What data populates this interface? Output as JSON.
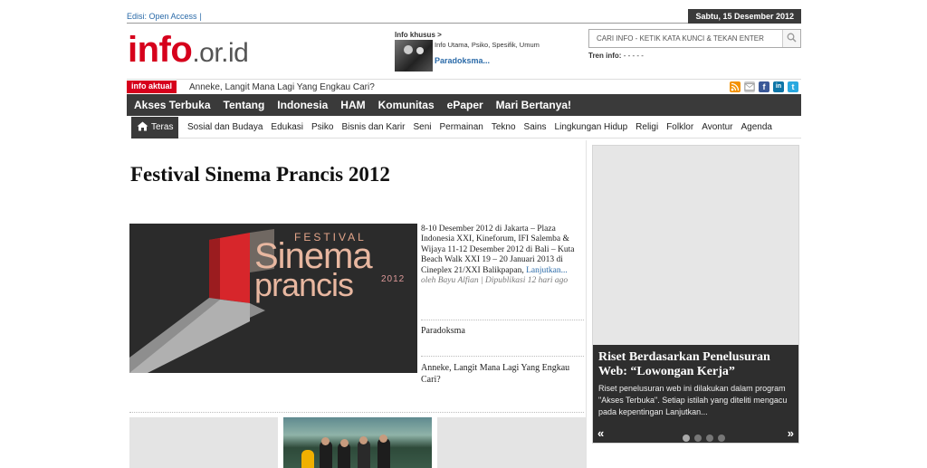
{
  "header": {
    "edition_label": "Edisi: Open Access",
    "edition_sep": "|",
    "date": "Sabtu, 15 Desember 2012",
    "logo_brand": "info",
    "logo_tld": ".or.id"
  },
  "special_info": {
    "label": "Info khusus >",
    "categories": "Info Utama, Psiko, Spesifik, Umum",
    "title": "Paradoksma..."
  },
  "search": {
    "placeholder": "CARI INFO - KETIK KATA KUNCI & TEKAN ENTER",
    "trend_label": "Tren info:",
    "trend_value": "- - - - -"
  },
  "ticker": {
    "tag": "info aktual",
    "headline": "Anneke, Langit Mana Lagi Yang Engkau Cari?"
  },
  "social": {
    "rss_color": "#f39200",
    "mail_color": "#c8c8c8",
    "facebook_color": "#3b5998",
    "linkedin_color": "#0e76a8",
    "twitter_color": "#2aa9e0",
    "facebook_glyph": "f",
    "linkedin_glyph": "in",
    "twitter_glyph": "t"
  },
  "main_nav": [
    "Akses Terbuka",
    "Tentang",
    "Indonesia",
    "HAM",
    "Komunitas",
    "ePaper",
    "Mari Bertanya!"
  ],
  "sub_nav": {
    "home": "Teras",
    "items": [
      "Sosial dan Budaya",
      "Edukasi",
      "Psiko",
      "Bisnis dan Karir",
      "Seni",
      "Permainan",
      "Tekno",
      "Sains",
      "Lingkungan Hidup",
      "Religi",
      "Folklor",
      "Avontur",
      "Agenda"
    ]
  },
  "article": {
    "title": "Festival Sinema Prancis 2012",
    "excerpt": "8-10 Desember 2012 di Jakarta – Plaza Indonesia XXI, Kineforum, IFI Salemba & Wijaya 11-12 Desember 2012 di Bali – Kuta Beach Walk XXI 19 – 20 Januari 2013 di Cineplex 21/XXI Balikpapan,",
    "more": "Lanjutkan...",
    "byline": "oleh Bayu Alfian | Dipublikasi 12 hari ago",
    "image": {
      "festival": "FESTIVAL",
      "word1": "Sinema",
      "word2": "prancis",
      "year": "2012"
    }
  },
  "related": [
    "Paradoksma",
    "Anneke, Langit Mana Lagi Yang Engkau Cari?"
  ],
  "slider": {
    "title": "Riset Berdasarkan Penelusuran Web: “Lowongan Kerja”",
    "text": "Riset penelusuran web ini dilakukan dalam program \"Akses Terbuka\". Setiap istilah yang diteliti mengacu pada kepentingan Lanjutkan...",
    "prev": "«",
    "next": "»"
  }
}
